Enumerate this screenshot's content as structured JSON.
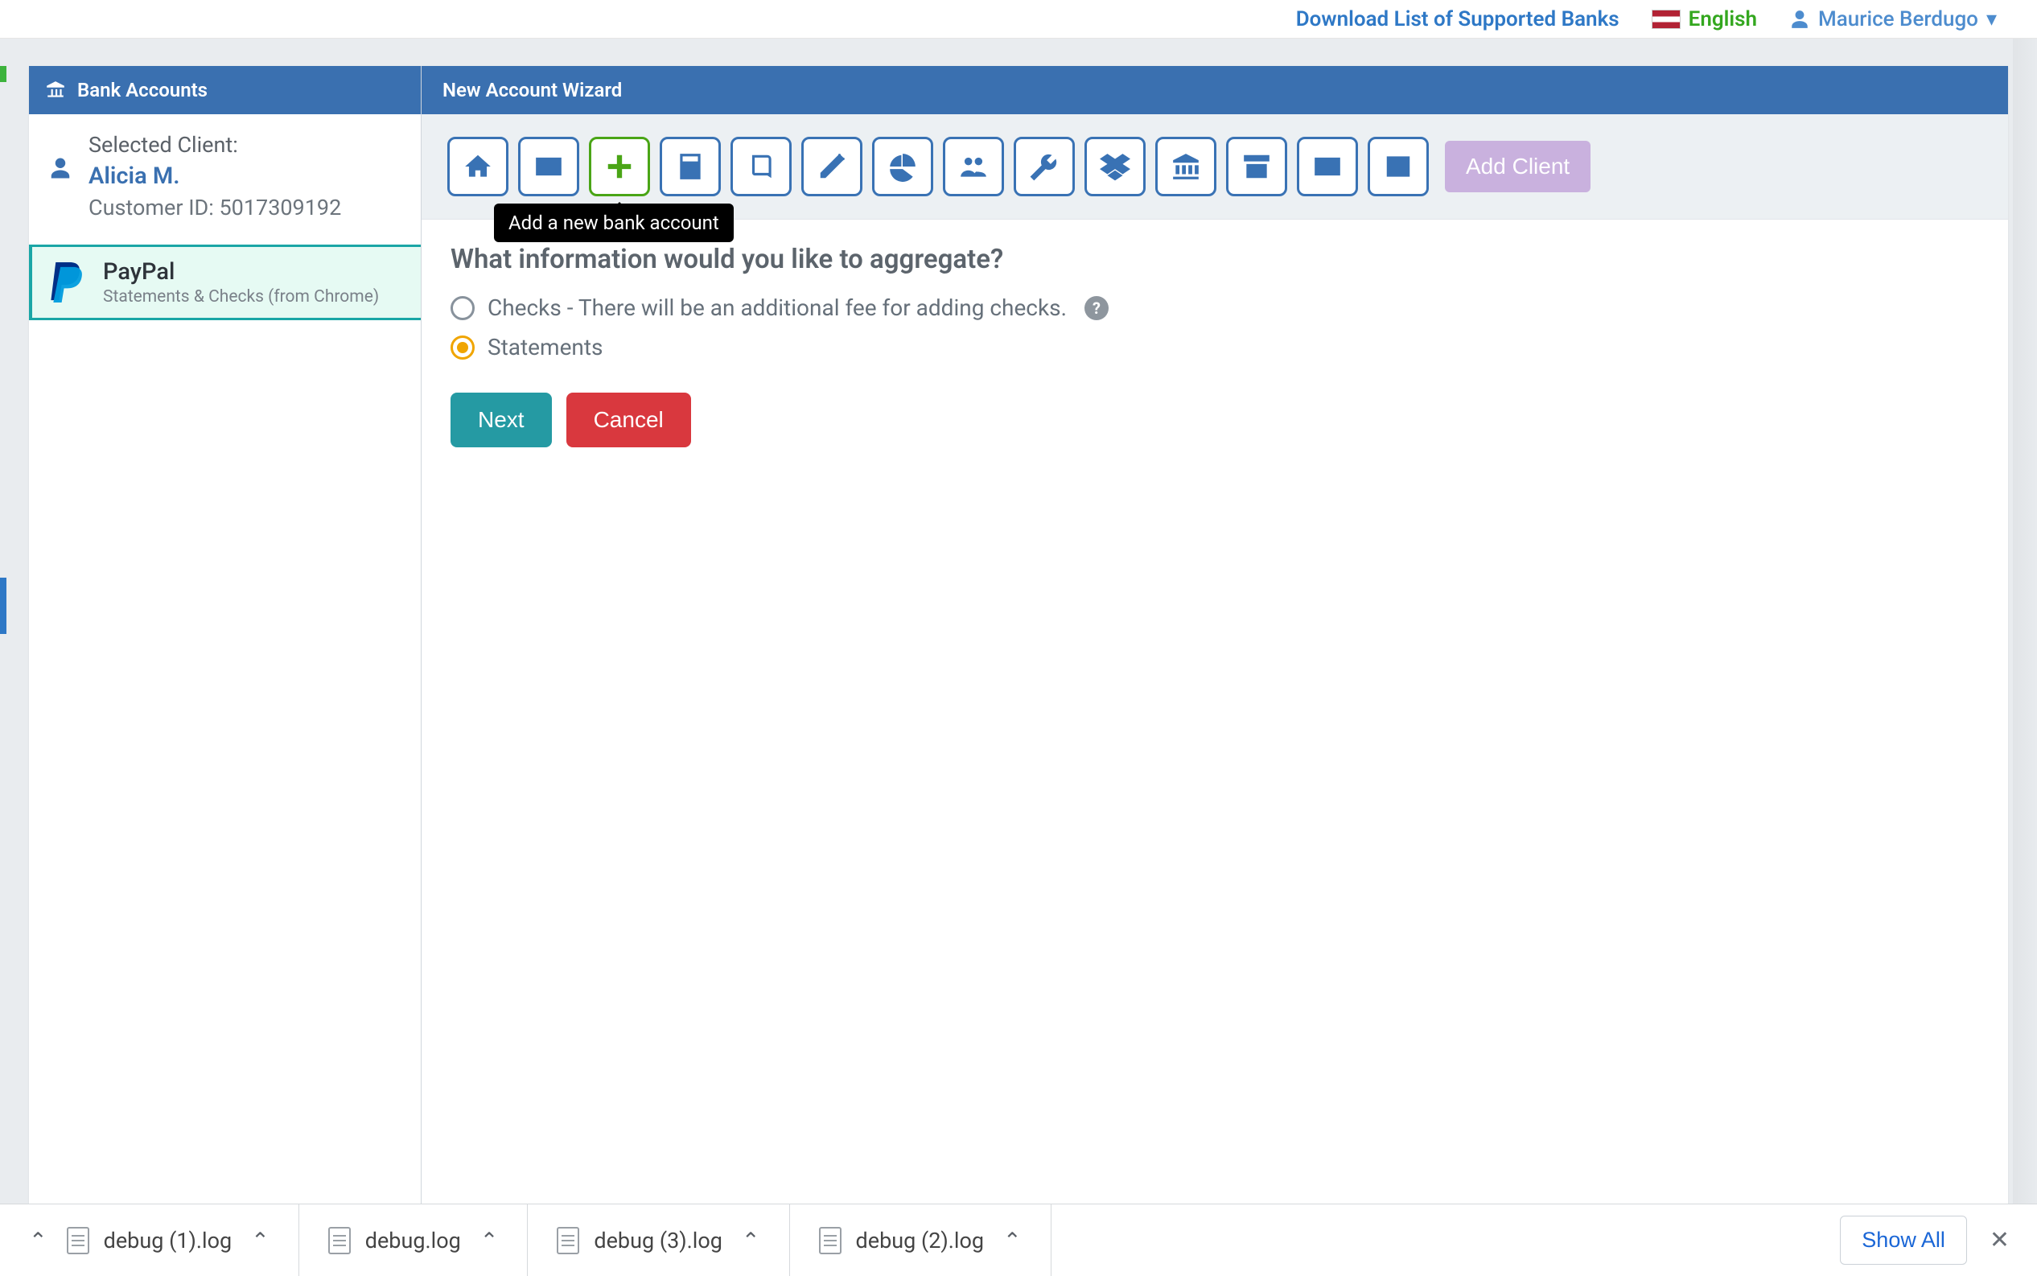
{
  "topbar": {
    "banks_link": "Download List of Supported Banks",
    "language": "English",
    "user_name": "Maurice Berdugo"
  },
  "sidebar": {
    "header": "Bank Accounts",
    "selected_label": "Selected Client:",
    "client_name": "Alicia M.",
    "customer_id_label": "Customer ID: 5017309192",
    "account": {
      "name": "PayPal",
      "sub": "Statements & Checks (from Chrome)"
    }
  },
  "main": {
    "header": "New Account Wizard",
    "toolbar": {
      "icons": [
        "home",
        "envelope",
        "plus",
        "calculator",
        "book",
        "edit",
        "pie",
        "users",
        "wrench",
        "dropbox",
        "bank",
        "archive",
        "card",
        "list"
      ],
      "active_index": 2,
      "tooltip": "Add a new bank account",
      "add_client": "Add Client"
    },
    "content": {
      "heading": "What information would you like to aggregate?",
      "options": [
        {
          "label": "Checks - There will be an additional fee for adding checks.",
          "help": true,
          "selected": false
        },
        {
          "label": "Statements",
          "help": false,
          "selected": true
        }
      ],
      "next": "Next",
      "cancel": "Cancel"
    }
  },
  "downloads": {
    "items": [
      "debug (1).log",
      "debug.log",
      "debug (3).log",
      "debug (2).log"
    ],
    "show_all": "Show All"
  }
}
